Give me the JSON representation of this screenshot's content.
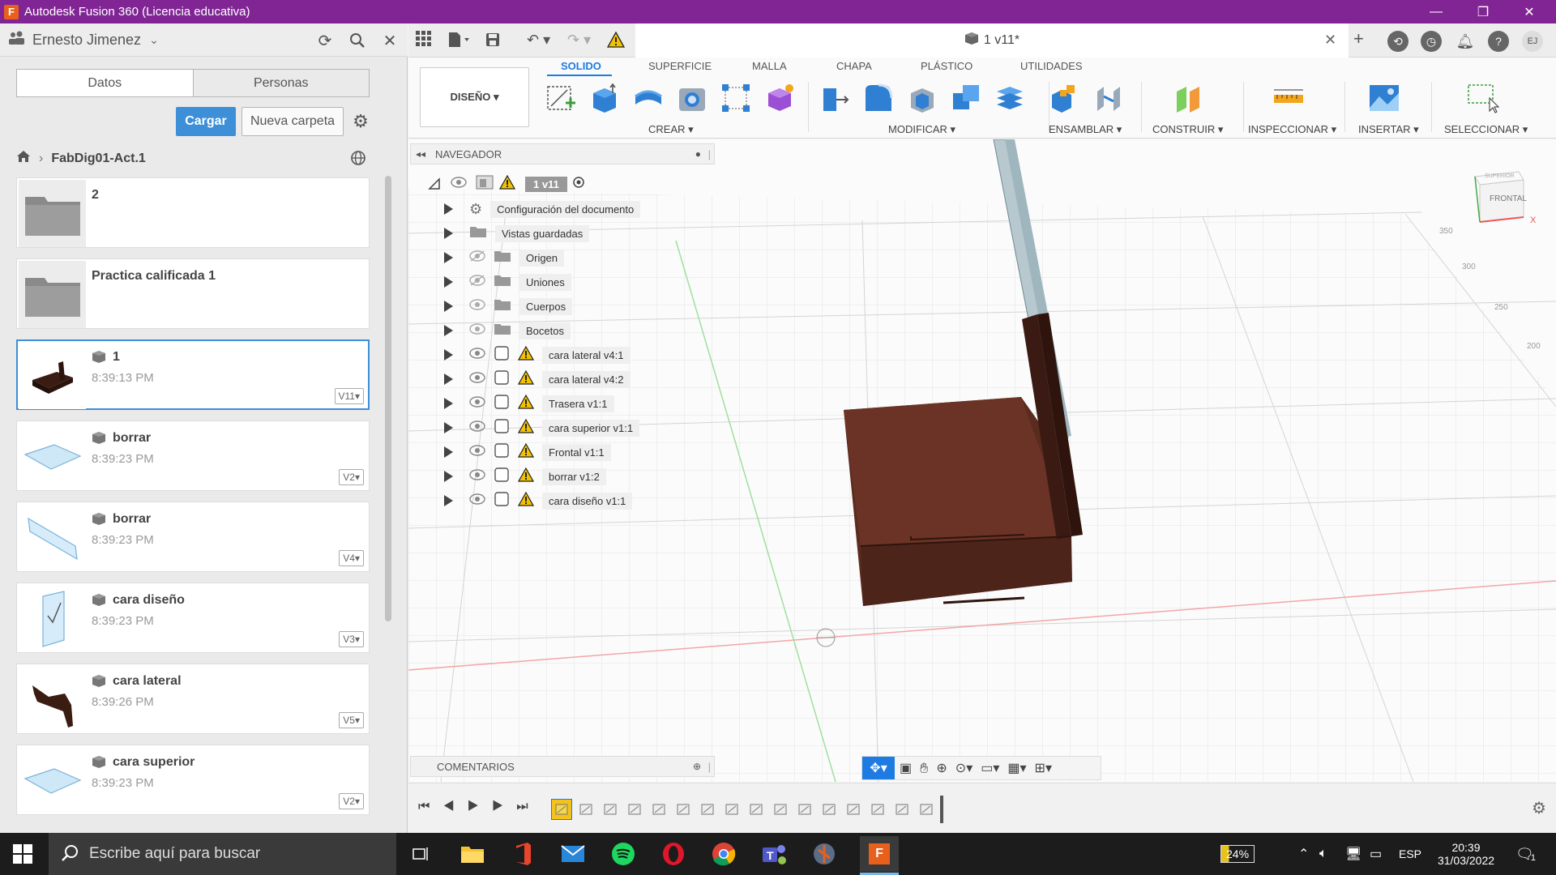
{
  "window": {
    "title": "Autodesk Fusion 360 (Licencia educativa)",
    "logo_letter": "F"
  },
  "data_panel": {
    "user": "Ernesto Jimenez",
    "tabs": [
      "Datos",
      "Personas"
    ],
    "upload_label": "Cargar",
    "new_folder_label": "Nueva carpeta",
    "breadcrumb": "FabDig01-Act.1",
    "items": [
      {
        "type": "folder",
        "name": "2"
      },
      {
        "type": "folder",
        "name": "Practica calificada 1"
      },
      {
        "type": "design",
        "name": "1",
        "time": "8:39:13 PM",
        "version": "V11"
      },
      {
        "type": "design",
        "name": "borrar",
        "time": "8:39:23 PM",
        "version": "V2"
      },
      {
        "type": "design",
        "name": "borrar",
        "time": "8:39:23 PM",
        "version": "V4"
      },
      {
        "type": "design",
        "name": "cara diseño",
        "time": "8:39:23 PM",
        "version": "V3"
      },
      {
        "type": "design",
        "name": "cara lateral",
        "time": "8:39:26 PM",
        "version": "V5"
      },
      {
        "type": "design",
        "name": "cara superior",
        "time": "8:39:23 PM",
        "version": "V2"
      }
    ]
  },
  "doc": {
    "tab_title": "1 v11*"
  },
  "toolbar": {
    "workspace": "DISEÑO ▾",
    "tabs": [
      "SOLIDO",
      "SUPERFICIE",
      "MALLA",
      "CHAPA",
      "PLÁSTICO",
      "UTILIDADES"
    ],
    "groups": [
      "CREAR ▾",
      "MODIFICAR ▾",
      "ENSAMBLAR ▾",
      "CONSTRUIR ▾",
      "INSPECCIONAR ▾",
      "INSERTAR ▾",
      "SELECCIONAR ▾"
    ]
  },
  "browser": {
    "title": "NAVEGADOR",
    "root": "1 v11",
    "items": [
      "Configuración del documento",
      "Vistas guardadas",
      "Origen",
      "Uniones",
      "Cuerpos",
      "Bocetos",
      "cara lateral v4:1",
      "cara lateral v4:2",
      "Trasera v1:1",
      "cara superior v1:1",
      "Frontal v1:1",
      "borrar v1:2",
      "cara diseño v1:1"
    ]
  },
  "viewcube": {
    "face": "FRONTAL",
    "top": "SUPERIOR",
    "axis": "X"
  },
  "ruler": [
    "350",
    "300",
    "250",
    "200"
  ],
  "comments_label": "COMENTARIOS",
  "taskbar": {
    "search_placeholder": "Escribe aquí para buscar",
    "battery": "24%",
    "lang": "ESP",
    "time": "20:39",
    "date": "31/03/2022",
    "notification_count": "1"
  }
}
